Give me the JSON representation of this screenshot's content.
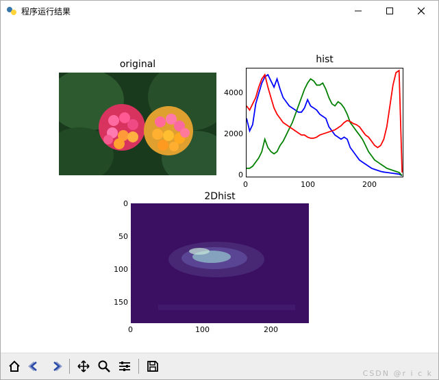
{
  "window": {
    "title": "程序运行结果"
  },
  "subplots": {
    "original": {
      "title": "original"
    },
    "hist": {
      "title": "hist",
      "x_ticks": [
        "0",
        "100",
        "200"
      ],
      "y_ticks": [
        "0",
        "2000",
        "4000"
      ]
    },
    "hist2d": {
      "title": "2Dhist",
      "x_ticks": [
        "0",
        "100",
        "200"
      ],
      "y_ticks": [
        "0",
        "50",
        "100",
        "150"
      ]
    }
  },
  "toolbar": {
    "home": "home-icon",
    "back": "back-icon",
    "forward": "forward-icon",
    "pan": "pan-icon",
    "zoom": "zoom-icon",
    "configure": "configure-icon",
    "save": "save-icon"
  },
  "watermark": "CSDN @r i c k",
  "chart_data": [
    {
      "type": "line",
      "title": "hist",
      "xlabel": "",
      "ylabel": "",
      "xlim": [
        0,
        256
      ],
      "ylim": [
        0,
        5200
      ],
      "x": [
        0,
        5,
        10,
        15,
        20,
        25,
        30,
        35,
        40,
        45,
        50,
        55,
        60,
        65,
        70,
        75,
        80,
        85,
        90,
        95,
        100,
        105,
        110,
        115,
        120,
        125,
        130,
        135,
        140,
        145,
        150,
        155,
        160,
        165,
        170,
        175,
        180,
        185,
        190,
        195,
        200,
        205,
        210,
        215,
        220,
        225,
        230,
        235,
        240,
        245,
        250,
        255
      ],
      "series": [
        {
          "name": "blue",
          "color": "#0000ff",
          "values": [
            2800,
            2200,
            2500,
            3500,
            4000,
            4500,
            4800,
            4900,
            4600,
            4300,
            4700,
            4200,
            3800,
            3600,
            3400,
            3300,
            3200,
            3100,
            3100,
            3300,
            3700,
            3400,
            3300,
            3200,
            3000,
            2900,
            2800,
            2400,
            2200,
            2000,
            1900,
            1800,
            1900,
            1800,
            1400,
            1200,
            1000,
            800,
            700,
            600,
            500,
            400,
            350,
            300,
            250,
            220,
            200,
            180,
            160,
            140,
            120,
            50
          ]
        },
        {
          "name": "green",
          "color": "#008000",
          "values": [
            400,
            400,
            500,
            700,
            900,
            1200,
            1800,
            1400,
            1200,
            1100,
            1200,
            1500,
            1700,
            2000,
            2300,
            2600,
            3000,
            3400,
            3800,
            4200,
            4500,
            4700,
            4600,
            4400,
            4400,
            4500,
            4200,
            3800,
            3500,
            3400,
            3600,
            3500,
            3300,
            3000,
            2600,
            2400,
            2200,
            2000,
            1800,
            1500,
            1200,
            1000,
            800,
            700,
            600,
            500,
            400,
            350,
            300,
            250,
            200,
            50
          ]
        },
        {
          "name": "red",
          "color": "#ff0000",
          "values": [
            3400,
            3200,
            3500,
            3800,
            4300,
            4700,
            4900,
            4300,
            3800,
            3300,
            3000,
            2800,
            2600,
            2500,
            2400,
            2300,
            2200,
            2100,
            2000,
            2000,
            1900,
            1850,
            1850,
            1900,
            2000,
            2050,
            2100,
            2150,
            2200,
            2250,
            2350,
            2450,
            2600,
            2700,
            2650,
            2550,
            2500,
            2400,
            2200,
            2000,
            1900,
            1700,
            1500,
            1400,
            1500,
            1800,
            2400,
            3400,
            4400,
            5000,
            5100,
            200
          ]
        }
      ]
    },
    {
      "type": "heatmap",
      "title": "2Dhist",
      "xlabel": "",
      "ylabel": "",
      "xlim": [
        0,
        256
      ],
      "ylim": [
        180,
        0
      ],
      "x_ticks": [
        0,
        100,
        200
      ],
      "y_ticks": [
        0,
        50,
        100,
        150
      ],
      "note": "2D hue-saturation histogram; bright region concentrated near x≈60-160, y≈60-110 with faint horizontal band near y≈160",
      "hot_clusters": [
        {
          "x_center": 120,
          "y_center": 85,
          "extent_x": 100,
          "extent_y": 40,
          "intensity": "high"
        },
        {
          "x_center": 150,
          "y_center": 155,
          "extent_x": 180,
          "extent_y": 10,
          "intensity": "low"
        }
      ],
      "colormap": "viridis"
    }
  ]
}
